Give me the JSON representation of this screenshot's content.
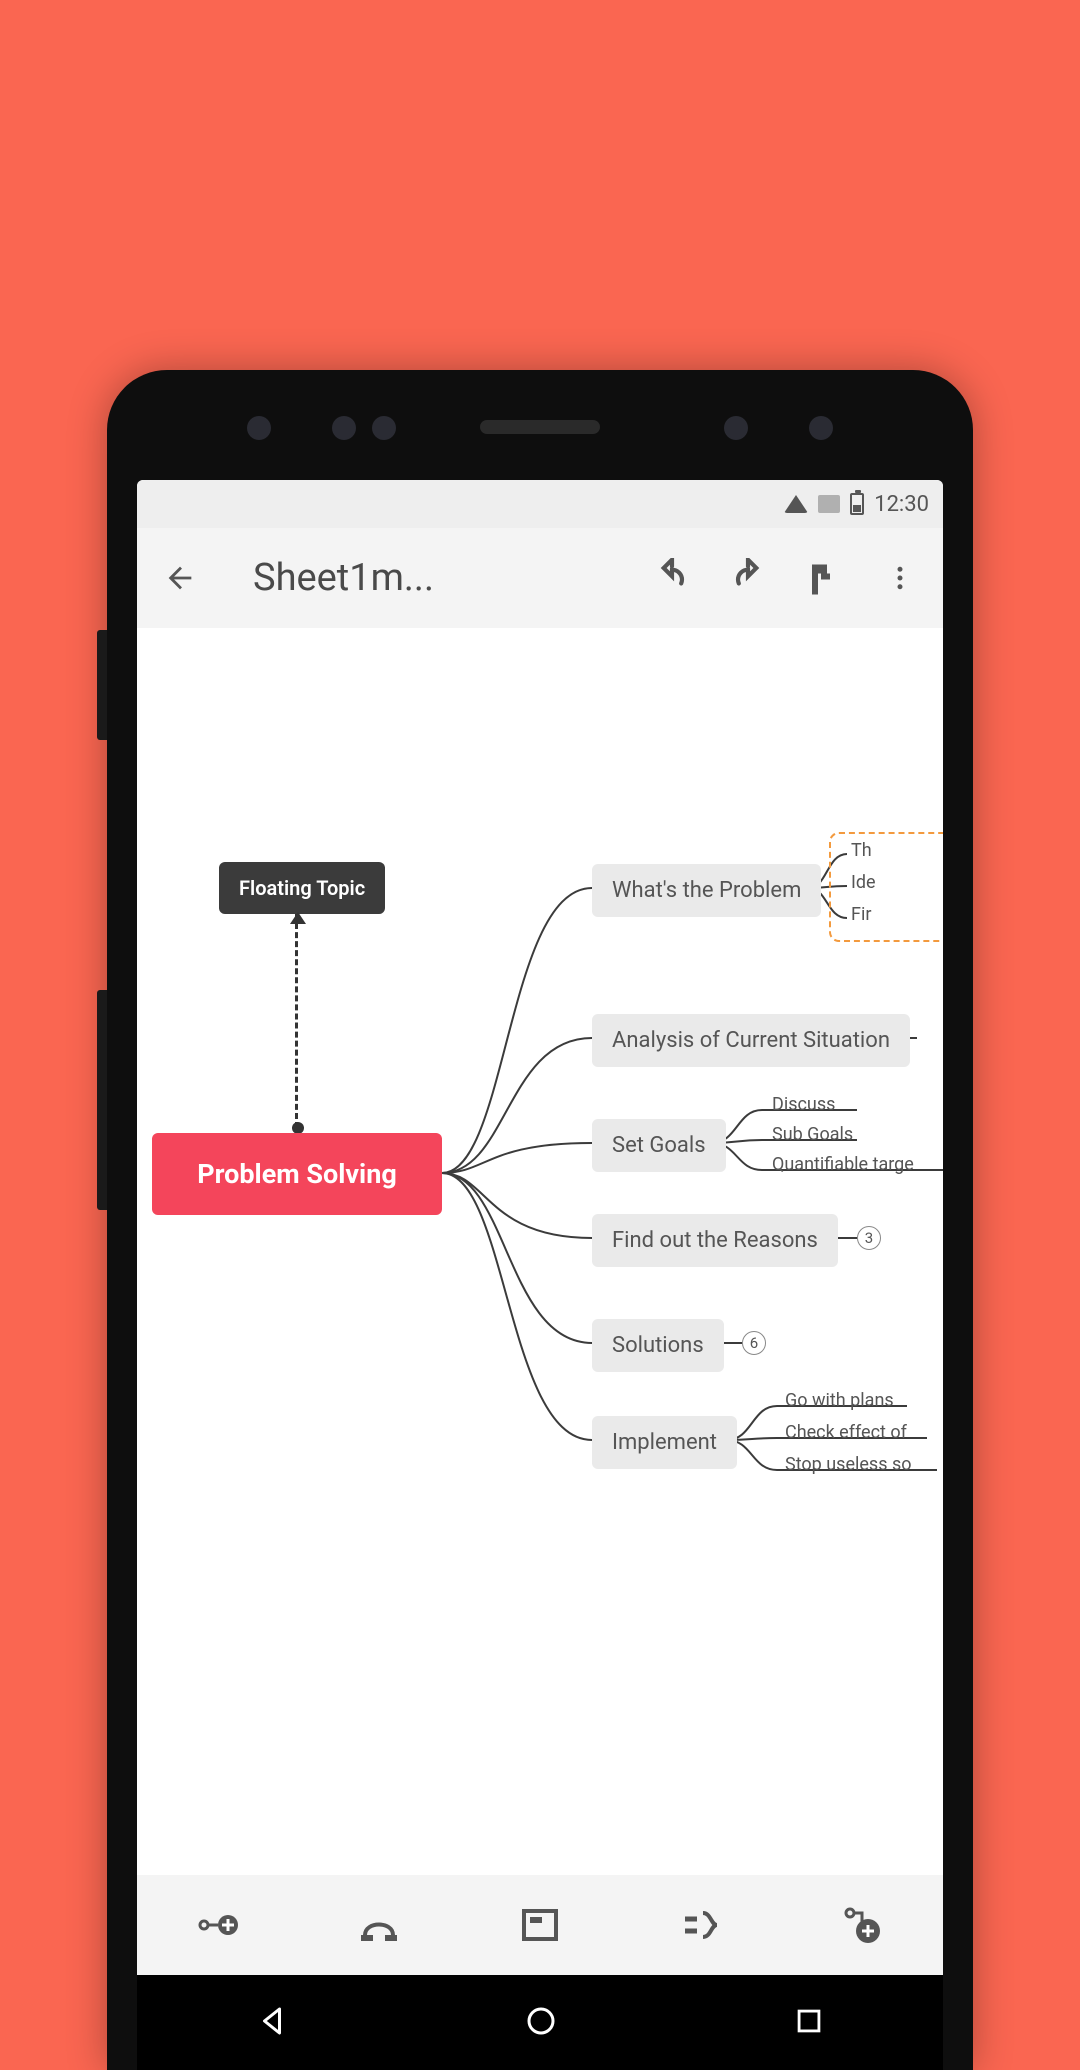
{
  "status": {
    "time": "12:30"
  },
  "appbar": {
    "title": "Sheet1m..."
  },
  "mindmap": {
    "root": "Problem Solving",
    "floating": "Floating Topic",
    "branches": [
      {
        "label": "What's the Problem",
        "leaves": [
          "Th",
          "Ide",
          "Fir"
        ]
      },
      {
        "label": "Analysis of Current Situation"
      },
      {
        "label": "Set Goals",
        "leaves": [
          "Discuss",
          "Sub Goals",
          "Quantifiable targe"
        ]
      },
      {
        "label": "Find out the Reasons",
        "count": "3"
      },
      {
        "label": "Solutions",
        "count": "6"
      },
      {
        "label": "Implement",
        "leaves": [
          "Go with plans",
          "Check effect of",
          "Stop useless so"
        ]
      }
    ]
  }
}
